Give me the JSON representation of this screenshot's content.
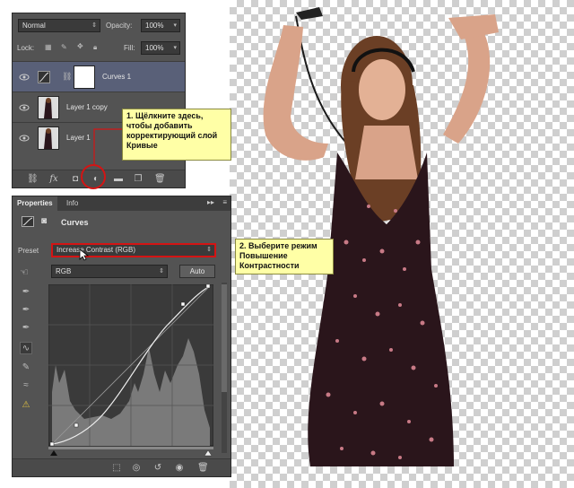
{
  "layers_panel": {
    "blend_mode": "Normal",
    "opacity_label": "Opacity:",
    "opacity_value": "100%",
    "lock_label": "Lock:",
    "fill_label": "Fill:",
    "fill_value": "100%",
    "layers": [
      {
        "name": "Curves 1",
        "selected": true
      },
      {
        "name": "Layer 1 copy",
        "selected": false
      },
      {
        "name": "Layer 1",
        "selected": false
      }
    ],
    "bottom_icons": [
      "link-icon",
      "fx-icon",
      "mask-icon",
      "adjustment-layer-icon",
      "folder-icon",
      "new-layer-icon",
      "trash-icon"
    ]
  },
  "properties_panel": {
    "tabs": [
      "Properties",
      "Info"
    ],
    "title": "Curves",
    "preset_label": "Preset",
    "preset_value": "Increase Contrast (RGB)",
    "channel_value": "RGB",
    "auto_label": "Auto"
  },
  "callouts": {
    "step1": "1. Щёлкните здесь, чтобы добавить корректирующий слой Кривые",
    "step2": "2. Выберите режим Повышение Контрастности"
  },
  "colors": {
    "panel_bg": "#535353",
    "selected_row": "#596078",
    "callout_bg": "#ffffa6",
    "highlight_red": "#d41414"
  }
}
